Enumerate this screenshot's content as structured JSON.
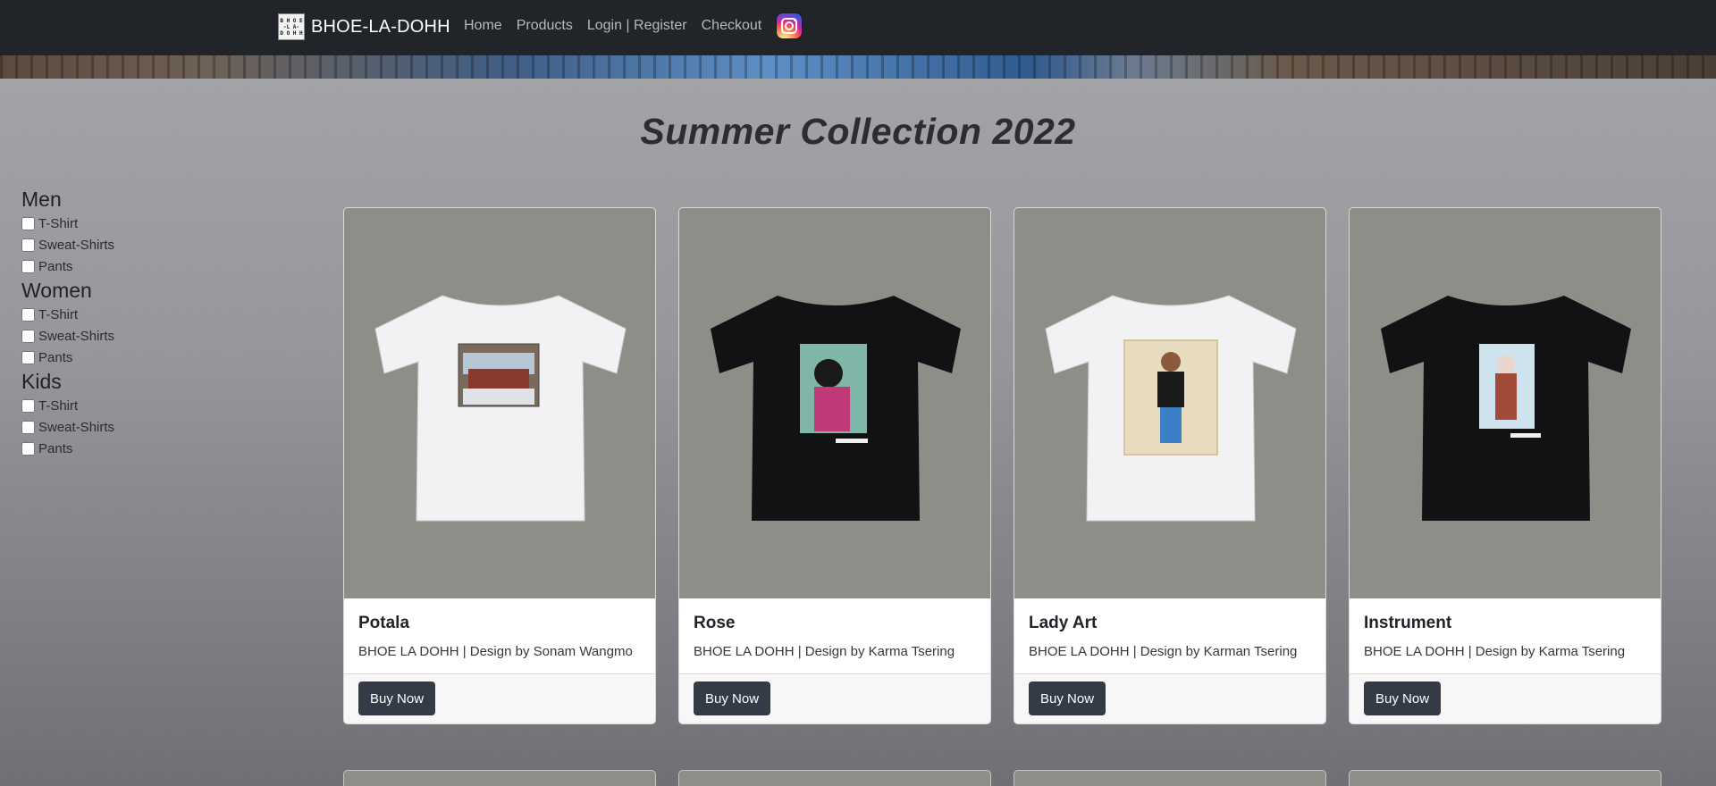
{
  "navbar": {
    "brand": "BHOE-LA-DOHH",
    "logo_text": "BHOE\n-LA-\nDOHH",
    "links": [
      "Home",
      "Products",
      "Login | Register",
      "Checkout"
    ],
    "instagram_icon": "instagram-icon"
  },
  "page": {
    "title": "Summer Collection 2022"
  },
  "sidebar": {
    "categories": [
      {
        "name": "Men",
        "options": [
          "T-Shirt",
          "Sweat-Shirts",
          "Pants"
        ]
      },
      {
        "name": "Women",
        "options": [
          "T-Shirt",
          "Sweat-Shirts",
          "Pants"
        ]
      },
      {
        "name": "Kids",
        "options": [
          "T-Shirt",
          "Sweat-Shirts",
          "Pants"
        ]
      }
    ]
  },
  "products": [
    {
      "name": "Potala",
      "description": "BHOE LA DOHH | Design by Sonam Wangmo",
      "button": "Buy Now",
      "shirt_color": "#f2f2f4"
    },
    {
      "name": "Rose",
      "description": "BHOE LA DOHH | Design by Karma Tsering",
      "button": "Buy Now",
      "shirt_color": "#111214"
    },
    {
      "name": "Lady Art",
      "description": "BHOE LA DOHH | Design by Karman Tsering",
      "button": "Buy Now",
      "shirt_color": "#f2f2f4"
    },
    {
      "name": "Instrument",
      "description": "BHOE LA DOHH | Design by Karma Tsering",
      "button": "Buy Now",
      "shirt_color": "#111214"
    }
  ],
  "colors": {
    "navbar_bg": "#212529",
    "button_bg": "#343a46",
    "image_bg": "#8f8d88"
  }
}
